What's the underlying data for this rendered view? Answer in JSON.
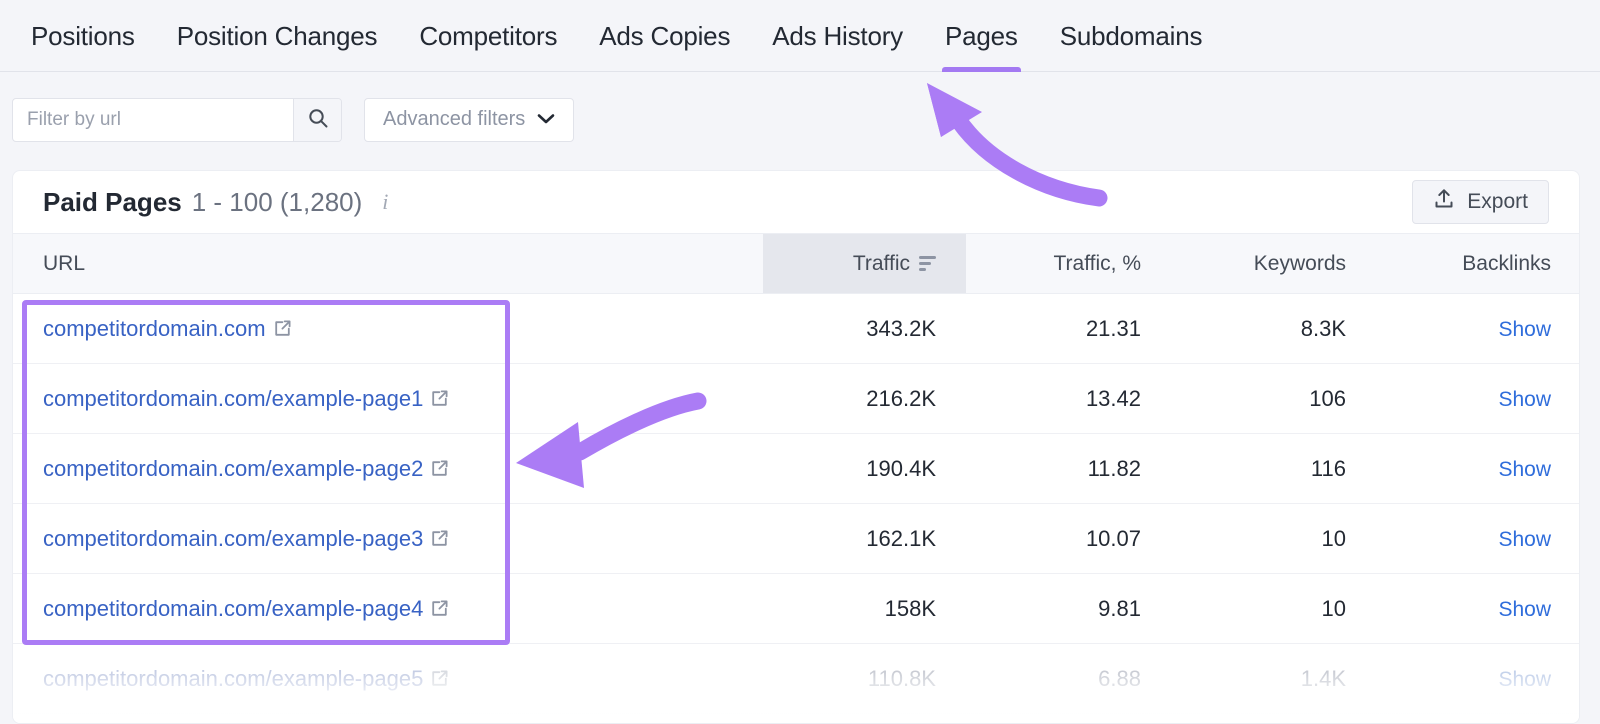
{
  "tabs": [
    {
      "label": "Positions",
      "active": false
    },
    {
      "label": "Position Changes",
      "active": false
    },
    {
      "label": "Competitors",
      "active": false
    },
    {
      "label": "Ads Copies",
      "active": false
    },
    {
      "label": "Ads History",
      "active": false
    },
    {
      "label": "Pages",
      "active": true
    },
    {
      "label": "Subdomains",
      "active": false
    }
  ],
  "filters": {
    "search_placeholder": "Filter by url",
    "search_value": "",
    "search_icon": "search-icon",
    "advanced_label": "Advanced filters",
    "advanced_icon": "chevron-down-icon"
  },
  "card": {
    "title": "Paid Pages",
    "range": "1 - 100 (1,280)",
    "info_icon": "info-icon",
    "export_label": "Export",
    "export_icon": "upload-icon"
  },
  "table": {
    "columns": [
      {
        "key": "url",
        "label": "URL",
        "align": "left",
        "sorted": false
      },
      {
        "key": "traffic",
        "label": "Traffic",
        "align": "right",
        "sorted": true,
        "sort_icon": "sort-descending-icon"
      },
      {
        "key": "traffic_pct",
        "label": "Traffic, %",
        "align": "right",
        "sorted": false
      },
      {
        "key": "keywords",
        "label": "Keywords",
        "align": "right",
        "sorted": false
      },
      {
        "key": "backlinks",
        "label": "Backlinks",
        "align": "right",
        "sorted": false
      }
    ],
    "rows": [
      {
        "url": "competitordomain.com",
        "traffic": "343.2K",
        "traffic_pct": "21.31",
        "keywords": "8.3K",
        "backlinks": "Show",
        "faded": false
      },
      {
        "url": "competitordomain.com/example-page1",
        "traffic": "216.2K",
        "traffic_pct": "13.42",
        "keywords": "106",
        "backlinks": "Show",
        "faded": false
      },
      {
        "url": "competitordomain.com/example-page2",
        "traffic": "190.4K",
        "traffic_pct": "11.82",
        "keywords": "116",
        "backlinks": "Show",
        "faded": false
      },
      {
        "url": "competitordomain.com/example-page3",
        "traffic": "162.1K",
        "traffic_pct": "10.07",
        "keywords": "10",
        "backlinks": "Show",
        "faded": false
      },
      {
        "url": "competitordomain.com/example-page4",
        "traffic": "158K",
        "traffic_pct": "9.81",
        "keywords": "10",
        "backlinks": "Show",
        "faded": false
      },
      {
        "url": "competitordomain.com/example-page5",
        "traffic": "110.8K",
        "traffic_pct": "6.88",
        "keywords": "1.4K",
        "backlinks": "Show",
        "faded": true
      }
    ],
    "external_link_icon": "external-link-icon"
  },
  "annotations": {
    "highlight_color": "#ab7cf5",
    "arrow_color": "#ab7cf5",
    "arrow_to_pages_tab": "arrow-pointing-to-pages-tab",
    "arrow_to_url_column": "arrow-pointing-to-url-column"
  },
  "colors": {
    "accent_purple": "#a379f2",
    "link_blue": "#3862c4",
    "page_background": "#f4f5f9",
    "card_background": "#ffffff"
  }
}
